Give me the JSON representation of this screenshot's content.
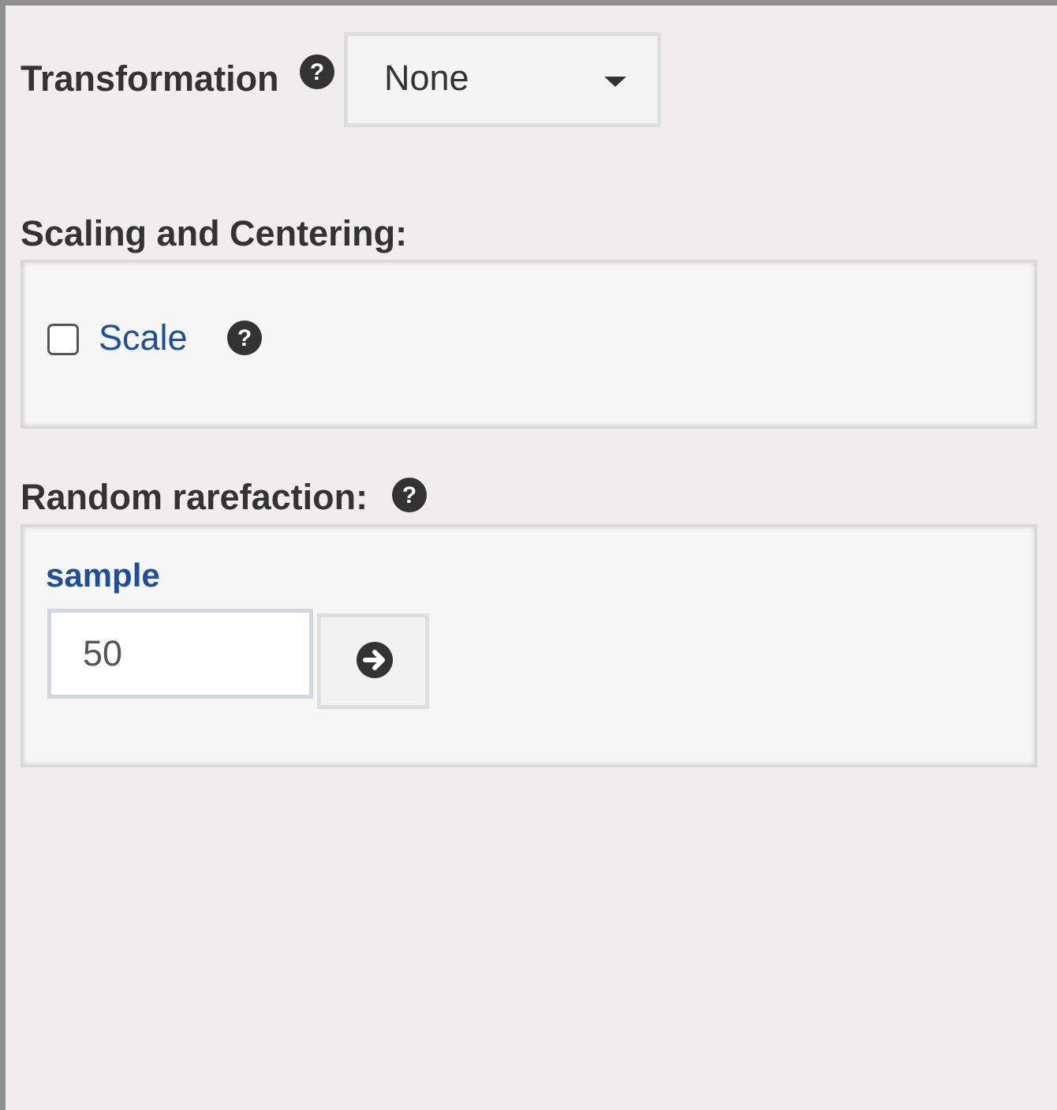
{
  "transformation": {
    "label": "Transformation",
    "help_icon": "question-circle-icon",
    "select": {
      "value": "None",
      "caret_icon": "caret-down-icon"
    }
  },
  "scaling": {
    "heading": "Scaling and Centering:",
    "checkbox_label": "Scale",
    "checkbox_checked": false,
    "help_icon": "question-circle-icon"
  },
  "rarefaction": {
    "heading": "Random rarefaction:",
    "help_icon": "question-circle-icon",
    "sample_label": "sample",
    "sample_value": "50",
    "submit_icon": "arrow-circle-right-icon"
  },
  "colors": {
    "background": "#efedee",
    "panel": "#f6f6f6",
    "label_blue": "#1f4e9a",
    "text": "#333333"
  }
}
